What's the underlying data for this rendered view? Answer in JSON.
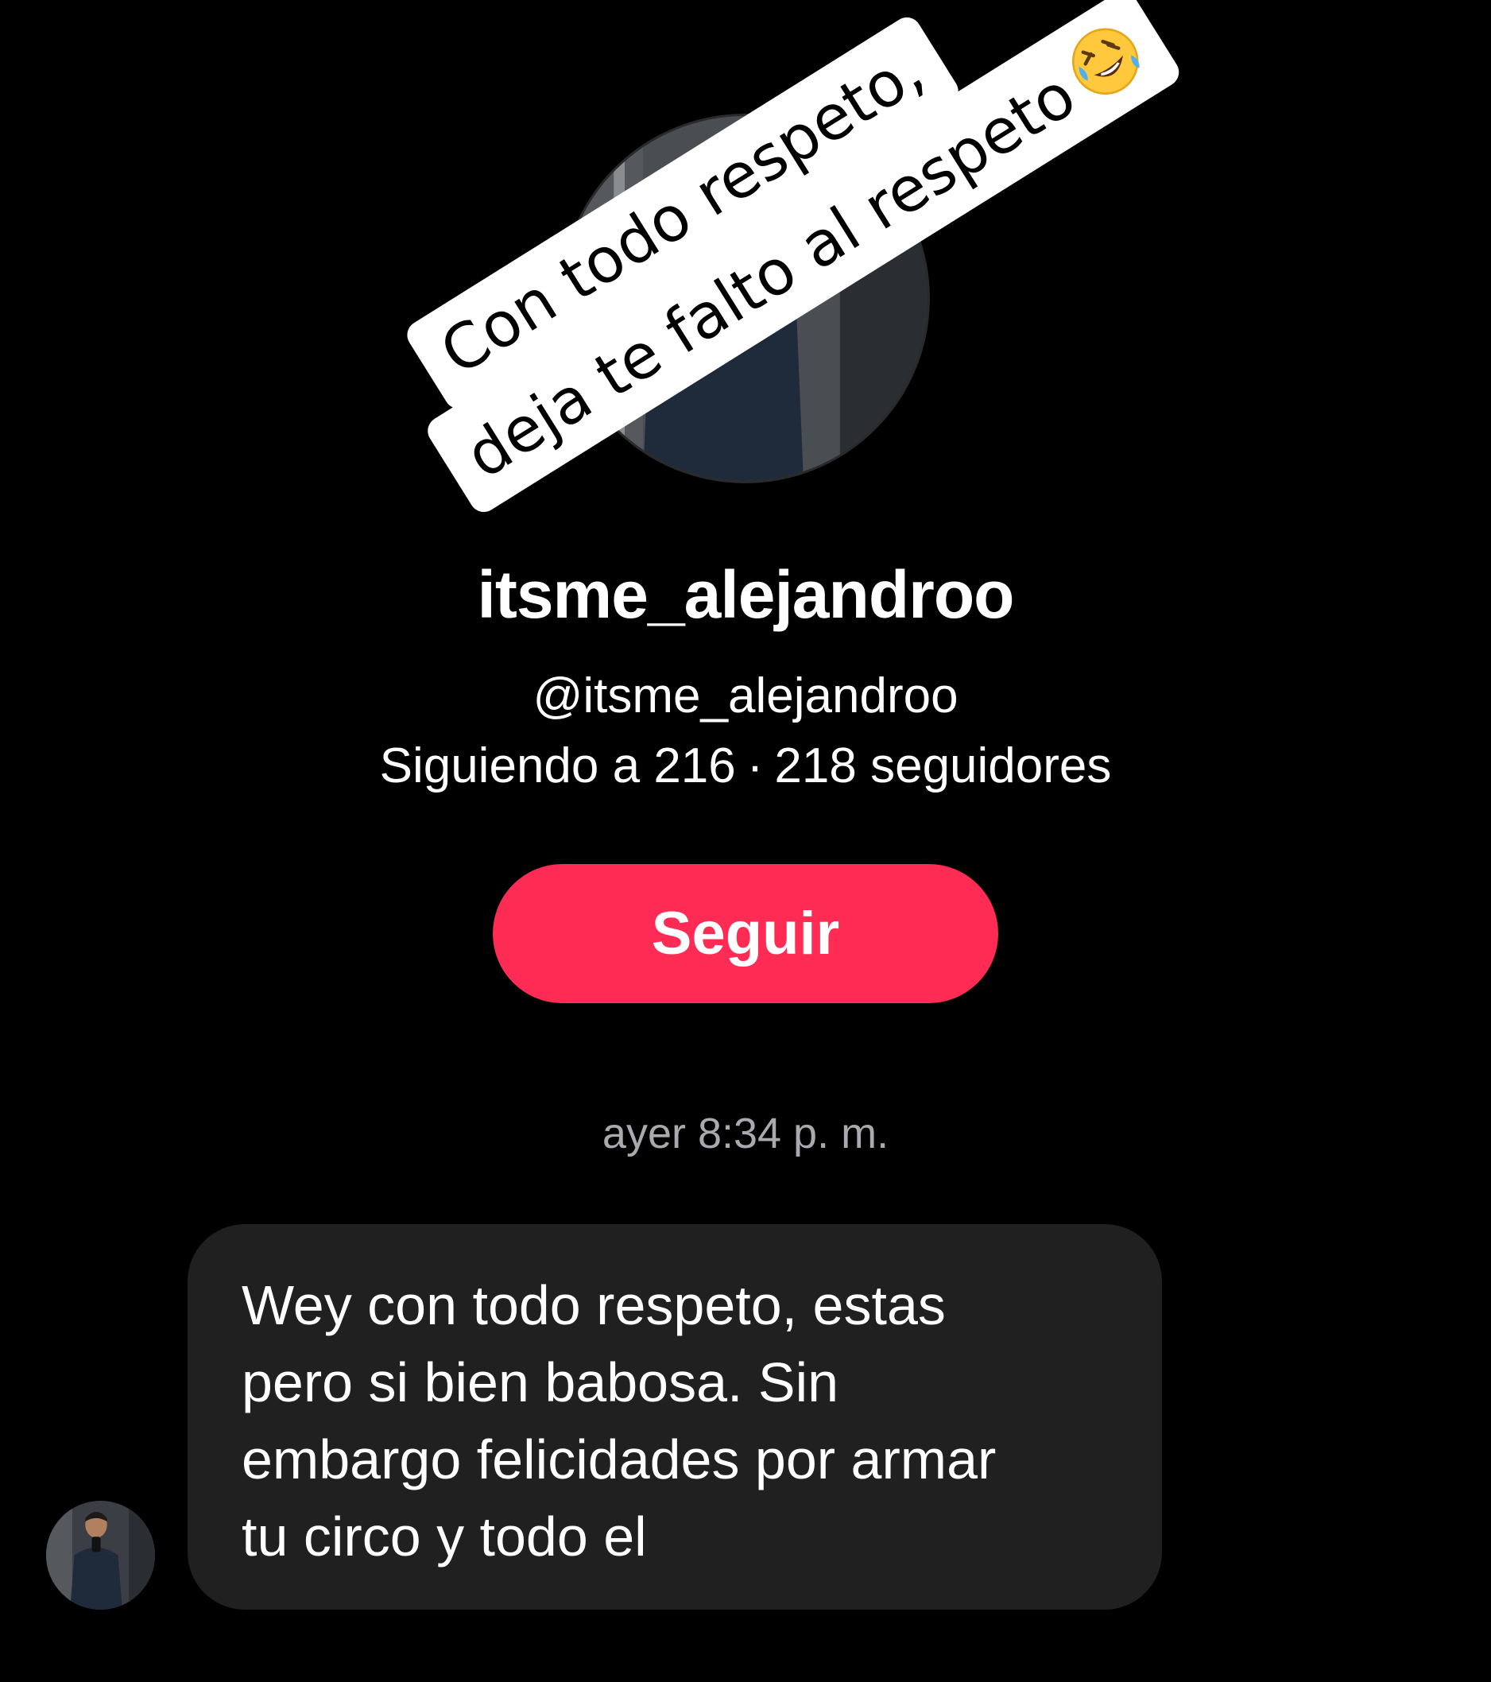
{
  "profile": {
    "display_name": "itsme_alejandroo",
    "handle": "@itsme_alejandroo",
    "following_text": "Siguiendo a 216",
    "separator": "·",
    "followers_text": "218 seguidores",
    "follow_label": "Seguir"
  },
  "sticker": {
    "line1": "Con todo respeto,",
    "line2": "deja te falto al respeto",
    "emoji": "rolling-on-floor-laughing-emoji"
  },
  "conversation": {
    "timestamp": "ayer 8:34 p. m.",
    "messages": [
      {
        "text": "Wey con todo respeto, estas\npero si bien babosa. Sin\nembargo felicidades por armar\ntu circo y todo el"
      }
    ]
  },
  "colors": {
    "background": "#000000",
    "accent": "#fe2c55",
    "bubble": "#202020",
    "timestamp": "#a9a9ae",
    "sticker_bg": "#ffffff"
  }
}
